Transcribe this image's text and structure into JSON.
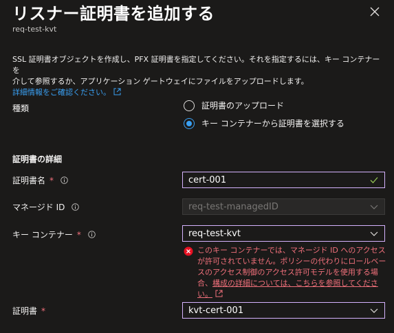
{
  "panel": {
    "title": "リスナー証明書を追加する",
    "subtitle": "req-test-kvt"
  },
  "description": {
    "line1": "SSL 証明書オブジェクトを作成し、PFX 証明書を指定してください。それを指定するには、キー コンテナーを",
    "line2": "介して参照するか、アプリケーション ゲートウェイにファイルをアップロードします。",
    "link": "詳細情報をご確認ください。"
  },
  "type": {
    "label": "種類",
    "options": [
      {
        "label": "証明書のアップロード",
        "checked": false
      },
      {
        "label": "キー コンテナーから証明書を選択する",
        "checked": true
      }
    ]
  },
  "details_heading": "証明書の詳細",
  "fields": {
    "cert_name": {
      "label": "証明書名",
      "required": "*",
      "value": "cert-001"
    },
    "managed_id": {
      "label": "マネージド ID",
      "value": "req-test-managedID"
    },
    "key_vault": {
      "label": "キー コンテナー",
      "required": "*",
      "value": "req-test-kvt"
    },
    "certificate": {
      "label": "証明書",
      "required": "*",
      "value": "kvt-cert-001"
    }
  },
  "error": {
    "text": "このキー コンテナーでは、マネージド ID へのアクセスが許可されていません。ポリシーの代わりにロールベースのアクセス制御のアクセス許可モデルを使用する場合、",
    "link": "構成の詳細については、こちらを参照してください。"
  },
  "colors": {
    "accent": "#3aa0f3",
    "error": "#f1707b",
    "field_border": "#d6b4ff",
    "success": "#92c353"
  }
}
